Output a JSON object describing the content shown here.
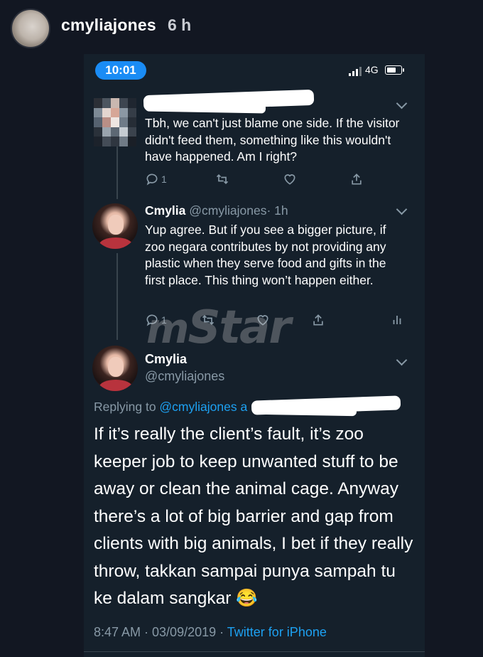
{
  "story": {
    "username": "cmyliajones",
    "time_ago": "6 h"
  },
  "status_bar": {
    "time": "10:01",
    "network": "4G"
  },
  "tweets": [
    {
      "text": "Tbh, we can't just blame one side. If the visitor didn't feed them, something like this wouldn't have happened. Am I right?",
      "reply_count": "1"
    },
    {
      "name": "Cmylia",
      "handle": "@cmyliajones",
      "time": "· 1h",
      "text": "Yup agree. But if you see a bigger picture, if zoo negara contributes by not providing any plastic when they serve food and gifts in the first place. This thing won’t happen either.",
      "reply_count": "1"
    }
  ],
  "main_tweet": {
    "name": "Cmylia",
    "handle": "@cmyliajones",
    "replying_prefix": "Replying to ",
    "replying_handle": "@cmyliajones a",
    "text": "If it’s really the client’s fault, it’s zoo keeper job to keep unwanted stuff to be away or clean the animal cage. Anyway there’s a lot of big barrier and gap from clients with big animals, I bet if they really throw, takkan sampai punya sampah tu ke dalam sangkar 😂",
    "timestamp": "8:47 AM · 03/09/2019 · ",
    "source": "Twitter for iPhone"
  },
  "watermark": {
    "prefix": "m",
    "text": "Star"
  },
  "icons": [
    "reply-icon",
    "retweet-icon",
    "like-icon",
    "share-icon",
    "analytics-icon",
    "chevron-down-icon"
  ],
  "colors": {
    "background": "#121722",
    "twitter_dark": "#15202b",
    "accent_blue": "#1da1f2",
    "clock_pill": "#1a8cf5",
    "muted": "#8899a6"
  }
}
